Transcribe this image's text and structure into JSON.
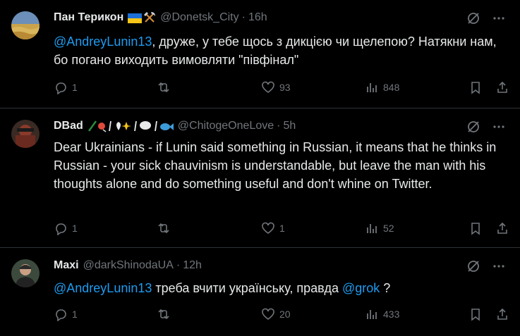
{
  "tweets": [
    {
      "name": "Пан Терикон",
      "handle": "@Donetsk_City",
      "time": "16h",
      "mention": "@AndreyLunin13",
      "text": ", друже, у тебе щось  з дикцією чи щелепою? Натякни нам, бо погано виходить вимовляти \"півфінал\"",
      "replies": "1",
      "retweets": "",
      "likes": "93",
      "views": "848"
    },
    {
      "name": "DBad",
      "handle": "@ChitogeOneLove",
      "time": "5h",
      "text": "Dear Ukrainians - if Lunin said something in Russian, it means that he thinks in Russian - your sick chauvinism is understandable, but leave the man with his thoughts alone and do something useful and don't whine on Twitter.",
      "replies": "1",
      "retweets": "",
      "likes": "1",
      "views": "52"
    },
    {
      "name": "Maxi",
      "handle": "@darkShinodaUA",
      "time": "12h",
      "mention": "@AndreyLunin13",
      "text": " треба вчити українську, правда ",
      "mention2": "@grok",
      "text2": " ?",
      "replies": "1",
      "retweets": "",
      "likes": "20",
      "views": "433"
    }
  ],
  "colors": {
    "accent": "#1d9bf0",
    "muted": "#71767b",
    "text": "#e7e9ea",
    "divider": "#2f3336"
  }
}
